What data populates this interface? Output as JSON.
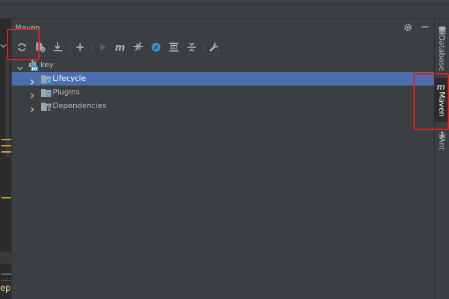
{
  "panel": {
    "title": "Maven"
  },
  "header_icons": [
    "gear-icon",
    "minimize-icon"
  ],
  "toolbar": {
    "buttons": [
      {
        "name": "reimport-all-maven-projects-button",
        "icon": "sync-icon"
      },
      {
        "name": "generate-sources-button",
        "icon": "generate-sources-icon"
      },
      {
        "name": "download-sources-button",
        "icon": "download-icon"
      },
      {
        "name": "add-maven-project-button",
        "icon": "plus-icon"
      },
      {
        "name": "run-maven-build-button",
        "icon": "run-icon"
      },
      {
        "name": "execute-maven-goal-button",
        "icon": "maven-m-icon"
      },
      {
        "name": "toggle-offline-mode-button",
        "icon": "offline-icon"
      },
      {
        "name": "toggle-skip-tests-button",
        "icon": "skip-tests-icon"
      },
      {
        "name": "show-dependencies-button",
        "icon": "diagram-icon"
      },
      {
        "name": "collapse-all-button",
        "icon": "collapse-all-icon"
      },
      {
        "name": "maven-settings-button",
        "icon": "wrench-icon"
      }
    ]
  },
  "tree": {
    "root": {
      "label": "key",
      "icon": "maven-module-icon"
    },
    "children": [
      {
        "label": "Lifecycle",
        "icon": "lifecycle-folder-icon",
        "selected": true
      },
      {
        "label": "Plugins",
        "icon": "plugins-folder-icon",
        "selected": false
      },
      {
        "label": "Dependencies",
        "icon": "dependencies-folder-icon",
        "selected": false
      }
    ]
  },
  "sidebar": {
    "tabs": [
      {
        "label": "Database",
        "icon": "database-icon",
        "active": false
      },
      {
        "label": "Maven",
        "icon": "maven-m-icon",
        "active": true
      },
      {
        "label": "Ant",
        "icon": "ant-icon",
        "active": false
      }
    ]
  },
  "editor": {
    "partial_text": "ep"
  },
  "colors": {
    "background": "#3c3f41",
    "selection": "#4b6eaf",
    "highlight": "#e0201c",
    "accent_blue": "#3592c4"
  }
}
